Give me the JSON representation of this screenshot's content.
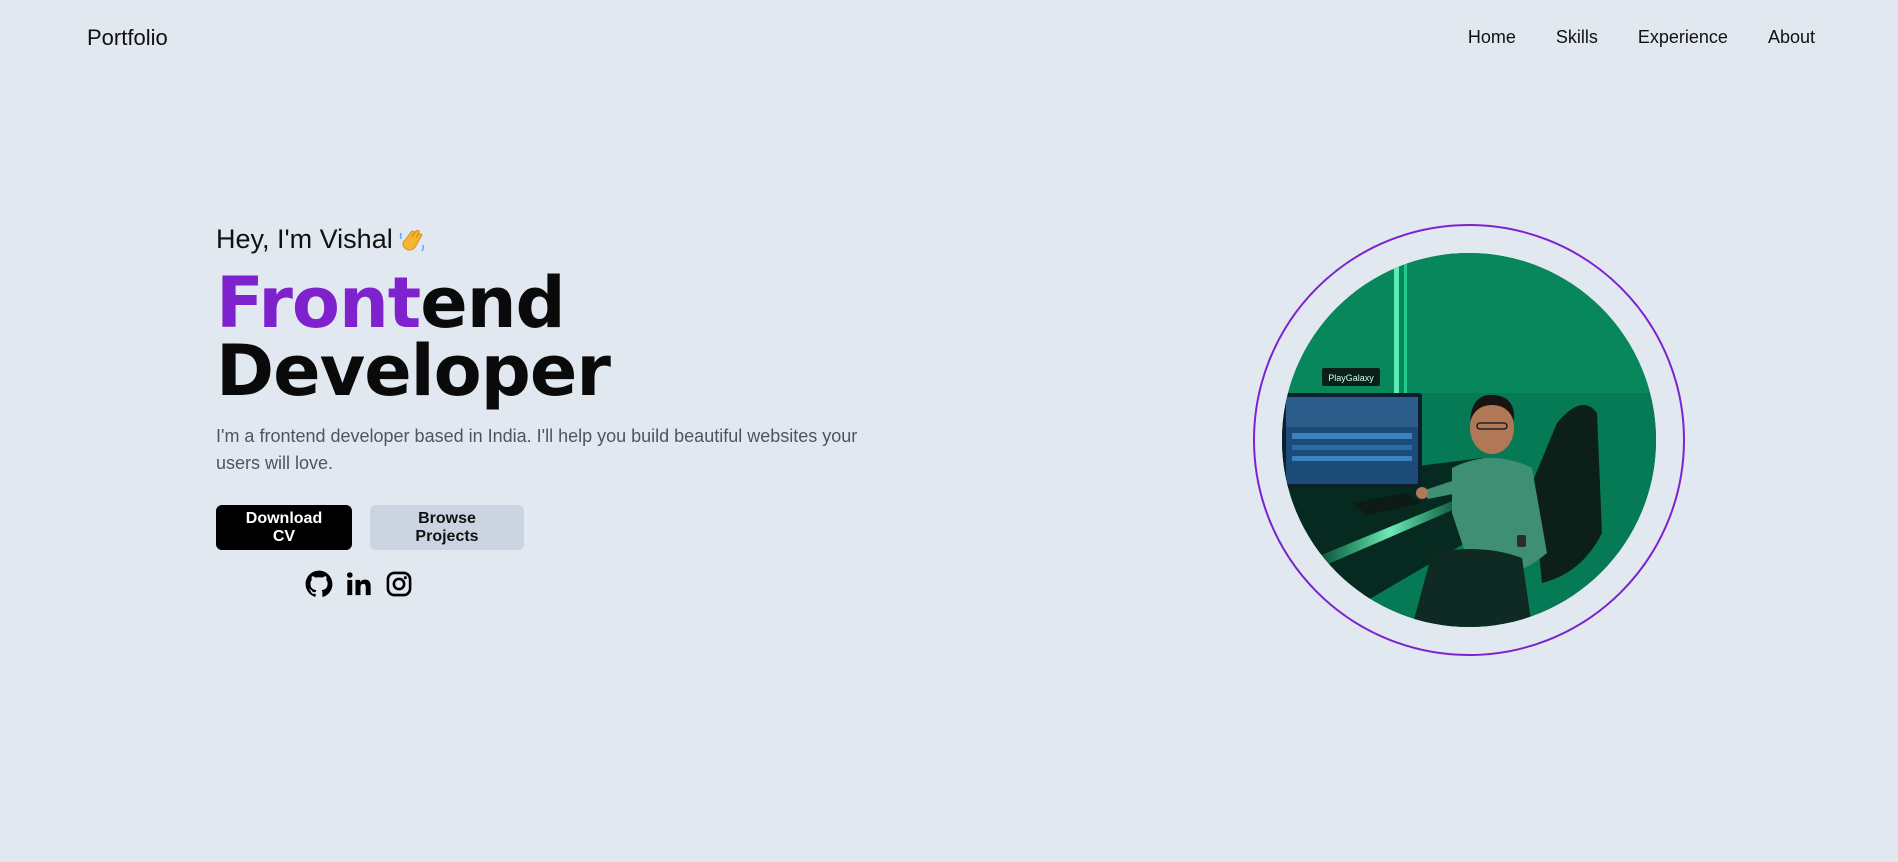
{
  "header": {
    "brand": "Portfolio",
    "nav": [
      "Home",
      "Skills",
      "Experience",
      "About"
    ]
  },
  "hero": {
    "greeting": "Hey, I'm Vishal",
    "greeting_icon": "waving-hand-icon",
    "title_accent": "Front",
    "title_rest": "end",
    "title_line2": "Developer",
    "intro": "I'm a frontend developer based in India. I'll help you build beautiful websites your users will love.",
    "buttons": {
      "download": "Download CV",
      "browse": "Browse Projects"
    },
    "socials": [
      "github-icon",
      "linkedin-icon",
      "instagram-icon"
    ],
    "portrait_sign": "PlayGalaxy"
  },
  "colors": {
    "background": "#e2e8f0",
    "accent": "#7e22ce",
    "primary_button": "#000000",
    "secondary_button": "#cbd5e1"
  }
}
